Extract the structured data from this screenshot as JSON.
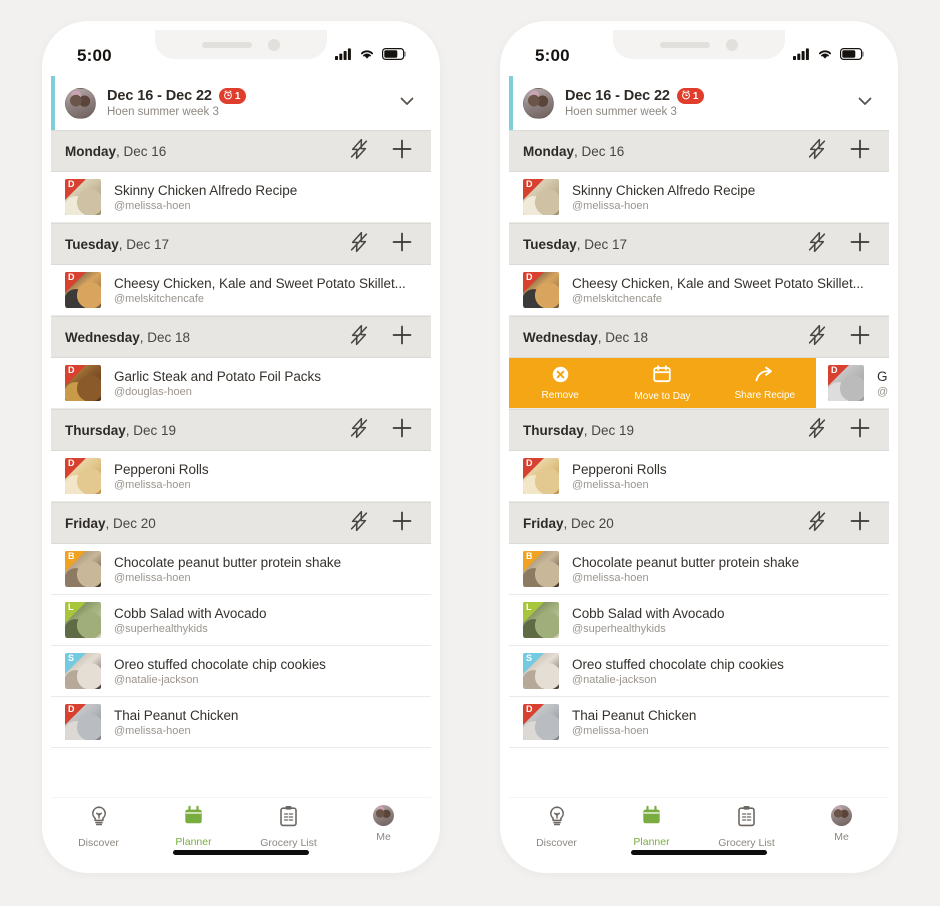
{
  "page": {
    "background_color": "#f2f1ef",
    "accent_color": "#7ecfd8",
    "swipe_action_color": "#f5a615",
    "badge_color": "#e03e2d",
    "active_tab_color": "#7aad3f"
  },
  "status_bar": {
    "time": "5:00",
    "signal_icon": "cellular-signal-icon",
    "wifi_icon": "wifi-icon",
    "battery_icon": "battery-icon"
  },
  "week_header": {
    "avatar_icon": "user-avatar",
    "title": "Dec 16 - Dec 22",
    "badge_icon": "alarm-clock-icon",
    "badge_count": "1",
    "subtitle": "Hoen summer week 3",
    "expand_icon": "chevron-down-icon"
  },
  "day_actions": {
    "quick_add_icon": "lightning-bolt-icon",
    "add_icon": "plus-icon"
  },
  "days": [
    {
      "weekday": "Monday",
      "date": ", Dec 16",
      "recipes": [
        {
          "title": "Skinny Chicken Alfredo Recipe",
          "author": "@melissa-hoen",
          "meal_letter": "D",
          "meal_color": "#d8412f",
          "thumb_colors": [
            "#cfc2a4",
            "#9a8e6e",
            "#efe9d8"
          ]
        }
      ]
    },
    {
      "weekday": "Tuesday",
      "date": ", Dec 17",
      "recipes": [
        {
          "title": "Cheesy Chicken, Kale and Sweet Potato Skillet...",
          "author": "@melskitchencafe",
          "meal_letter": "D",
          "meal_color": "#d8412f",
          "thumb_colors": [
            "#d8a45e",
            "#6e5a3c",
            "#3c3a38"
          ]
        }
      ]
    },
    {
      "weekday": "Wednesday",
      "date": ", Dec 18",
      "recipes": [
        {
          "title": "Garlic Steak and Potato Foil Packs",
          "author": "@douglas-hoen",
          "meal_letter": "D",
          "meal_color": "#d8412f",
          "thumb_colors": [
            "#8a5a2b",
            "#4a3018",
            "#c99a48"
          ]
        }
      ]
    },
    {
      "weekday": "Thursday",
      "date": ", Dec 19",
      "recipes": [
        {
          "title": "Pepperoni Rolls",
          "author": "@melissa-hoen",
          "meal_letter": "D",
          "meal_color": "#d8412f",
          "thumb_colors": [
            "#e3c98f",
            "#c08f4a",
            "#f3e6c8"
          ]
        }
      ]
    },
    {
      "weekday": "Friday",
      "date": ", Dec 20",
      "recipes": [
        {
          "title": "Chocolate peanut butter protein shake",
          "author": "@melissa-hoen",
          "meal_letter": "B",
          "meal_color": "#f0a323",
          "thumb_colors": [
            "#c9b79a",
            "#3a2e26",
            "#8d7a62"
          ]
        },
        {
          "title": "Cobb Salad with Avocado",
          "author": "@superhealthykids",
          "meal_letter": "L",
          "meal_color": "#a8c63c",
          "thumb_colors": [
            "#9fae7a",
            "#d8d2c4",
            "#5e6b45"
          ]
        },
        {
          "title": "Oreo stuffed chocolate chip cookies",
          "author": "@natalie-jackson",
          "meal_letter": "S",
          "meal_color": "#72cbe0",
          "thumb_colors": [
            "#e4ded4",
            "#43382f",
            "#b6a999"
          ]
        },
        {
          "title": "Thai Peanut Chicken",
          "author": "@melissa-hoen",
          "meal_letter": "D",
          "meal_color": "#d8412f",
          "thumb_colors": [
            "#b9bcc0",
            "#7e8186",
            "#dcd9d4"
          ]
        }
      ]
    }
  ],
  "swipe_actions": {
    "visible_on_day": "Wednesday",
    "items": [
      {
        "label": "Remove",
        "icon": "close-circle-icon"
      },
      {
        "label": "Move to Day",
        "icon": "calendar-icon"
      },
      {
        "label": "Share Recipe",
        "icon": "share-arrow-icon"
      }
    ],
    "revealed_recipe": {
      "title": "G",
      "author": "@",
      "meal_letter": "D",
      "meal_color": "#d8412f"
    }
  },
  "tab_bar": {
    "tabs": [
      {
        "label": "Discover",
        "icon": "lightbulb-icon",
        "active": false
      },
      {
        "label": "Planner",
        "icon": "calendar-icon",
        "active": true
      },
      {
        "label": "Grocery List",
        "icon": "clipboard-list-icon",
        "active": false
      },
      {
        "label": "Me",
        "icon": "user-avatar-icon",
        "active": false
      }
    ]
  }
}
